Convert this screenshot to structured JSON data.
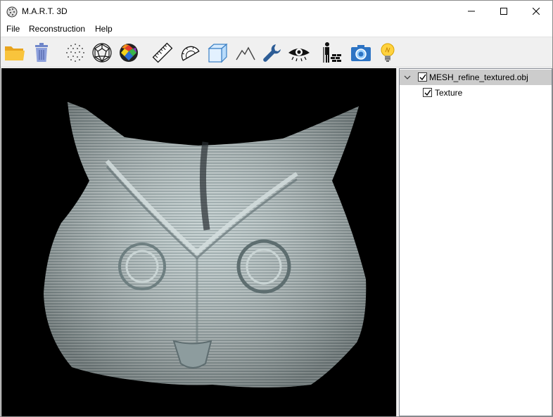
{
  "window": {
    "title": "M.A.R.T. 3D"
  },
  "menu": [
    "File",
    "Reconstruction",
    "Help"
  ],
  "toolbar": {
    "tools": [
      {
        "name": "open-folder-icon"
      },
      {
        "name": "trash-icon"
      },
      {
        "name": "point-cloud-icon"
      },
      {
        "name": "wireframe-sphere-icon"
      },
      {
        "name": "colored-mesh-icon"
      },
      {
        "name": "ruler-icon"
      },
      {
        "name": "protractor-icon"
      },
      {
        "name": "bounding-box-icon"
      },
      {
        "name": "terrain-icon"
      },
      {
        "name": "wrench-icon"
      },
      {
        "name": "eye-icon"
      },
      {
        "name": "surveyor-icon"
      },
      {
        "name": "camera-icon"
      },
      {
        "name": "lightbulb-icon"
      }
    ]
  },
  "scene": {
    "object": "textured owl head mesh",
    "background": "#000000",
    "mesh_color": "#a7b6b7"
  },
  "tree": {
    "root": {
      "label": "MESH_refine_textured.obj",
      "checked": true,
      "expanded": true,
      "selected": true
    },
    "children": [
      {
        "label": "Texture",
        "checked": true
      }
    ]
  },
  "colors": {
    "selection": "#cccccc",
    "toolbar_bg": "#f0f0f0"
  }
}
